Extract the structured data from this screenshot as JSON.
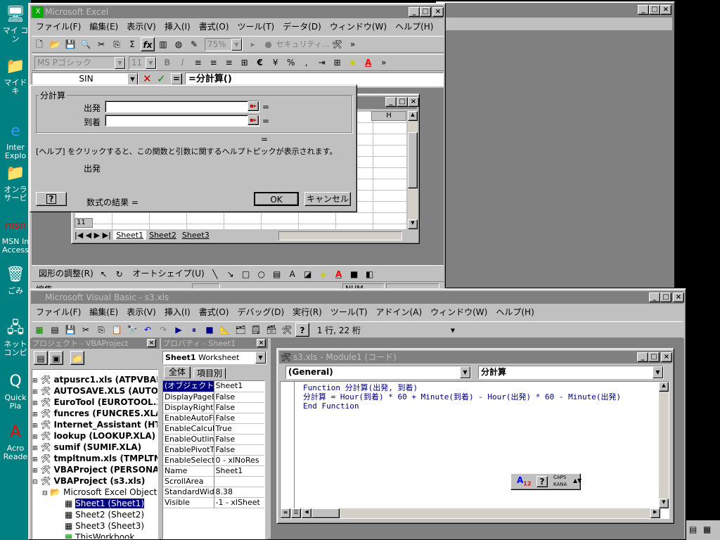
{
  "desktop": {
    "icons": [
      "マイ コン",
      "マイド キ",
      "Inter Explo",
      "オンラ サービ",
      "MSN In Access",
      "ごみ",
      "ネット コンピ",
      "Quick Pla",
      "Acro Reade"
    ]
  },
  "excel": {
    "title": "Microsoft Excel",
    "menu": [
      "ファイル(F)",
      "編集(E)",
      "表示(V)",
      "挿入(I)",
      "書式(O)",
      "ツール(T)",
      "データ(D)",
      "ウィンドウ(W)",
      "ヘルプ(H)"
    ],
    "font_name": "MS Pゴシック",
    "font_size": "11",
    "zoom": "75%",
    "security": "セキュリティ...",
    "name_box": "SIN",
    "formula": "=分計算()",
    "equals": "=",
    "draw_label": "図形の調整(R)",
    "autoshape": "オートシェイプ(U)",
    "status_left": "編集",
    "status_num": "NUM",
    "sheet": {
      "col_h": "H",
      "row11": "11",
      "tabs": [
        "Sheet1",
        "Sheet2",
        "Sheet3"
      ]
    },
    "dialog": {
      "group": "分計算",
      "arg1": "出発",
      "arg2": "到着",
      "arg1_eq": "=",
      "arg2_eq": "=",
      "result_eq": "=",
      "help_text": "[ヘルプ] をクリックすると、この関数と引数に関するヘルプトピックが表示されます。",
      "arg_desc": "出発",
      "result_label": "数式の結果 =",
      "ok": "OK",
      "cancel": "キャンセル"
    }
  },
  "vbe": {
    "title": "Microsoft Visual Basic - s3.xls",
    "menu": [
      "ファイル(F)",
      "編集(E)",
      "表示(V)",
      "挿入(I)",
      "書式(O)",
      "デバッグ(D)",
      "実行(R)",
      "ツール(T)",
      "アドイン(A)",
      "ウィンドウ(W)",
      "ヘルプ(H)"
    ],
    "position": "1 行, 22 桁",
    "project": {
      "title": "プロジェクト - VBAProject",
      "items": [
        "atpusrc1.xls (ATPVBAE",
        "AUTOSAVE.XLS (AUTO",
        "EuroTool (EUROTOOL.X",
        "funcres (FUNCRES.XLA",
        "Internet_Assistant (HTI",
        "lookup (LOOKUP.XLA)",
        "sumif (SUMIF.XLA)",
        "tmpltnum.xls (TMPLTNU",
        "VBAProject (PERSONA",
        "VBAProject (s3.xls)"
      ],
      "folder": "Microsoft Excel Objects",
      "children": [
        "Sheet1 (Sheet1)",
        "Sheet2 (Sheet2)",
        "Sheet3 (Sheet3)",
        "ThisWorkbook"
      ]
    },
    "props": {
      "title": "プロパティ - Sheet1",
      "object": "Sheet1",
      "object_type": "Worksheet",
      "tab1": "全体",
      "tab2": "項目別",
      "rows": [
        [
          "(オブジェクト名)",
          "Sheet1"
        ],
        [
          "DisplayPageB",
          "False"
        ],
        [
          "DisplayRightT",
          "False"
        ],
        [
          "EnableAutoFil",
          "False"
        ],
        [
          "EnableCalcula",
          "True"
        ],
        [
          "EnableOutlinir",
          "False"
        ],
        [
          "EnablePivotTa",
          "False"
        ],
        [
          "EnableSelecti",
          "0 - xlNoRes"
        ],
        [
          "Name",
          "Sheet1"
        ],
        [
          "ScrollArea",
          ""
        ],
        [
          "StandardWidth",
          "8.38"
        ],
        [
          "Visible",
          "-1 - xlSheet"
        ]
      ]
    },
    "code": {
      "title": "s3.xls - Module1 (コード)",
      "object": "(General)",
      "proc": "分計算",
      "lines": [
        "Function 分計算(出発, 到着)",
        "分計算 = Hour(到着) * 60 + Minute(到着) - Hour(出発) * 60 - Minute(出発)",
        "End Function"
      ]
    },
    "ime": {
      "caps": "CAPS",
      "kana": "KANA"
    }
  }
}
